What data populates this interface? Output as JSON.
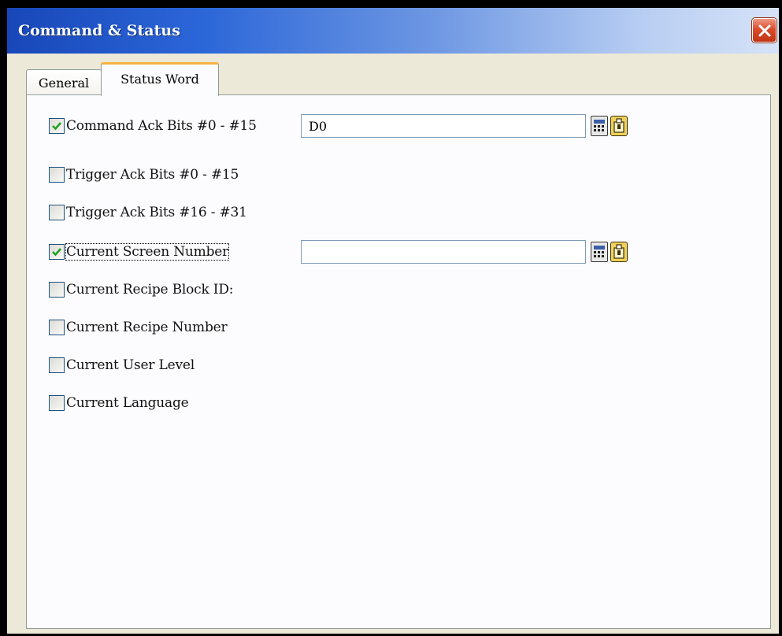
{
  "window": {
    "title": "Command & Status"
  },
  "tabs": [
    {
      "label": "General",
      "active": false
    },
    {
      "label": "Status Word",
      "active": true
    }
  ],
  "rows": [
    {
      "label": "Command Ack Bits #0 - #15",
      "checked": true,
      "address_value": "D0"
    },
    {
      "label": "Trigger Ack Bits #0 - #15",
      "checked": false
    },
    {
      "label": "Trigger Ack Bits #16 - #31",
      "checked": false
    },
    {
      "label": "Current Screen Number",
      "checked": true,
      "address_value": ""
    },
    {
      "label": "Current Recipe Block ID:",
      "checked": false
    },
    {
      "label": "Current Recipe Number",
      "checked": false
    },
    {
      "label": "Current User Level",
      "checked": false
    },
    {
      "label": "Current Language",
      "checked": false
    }
  ],
  "icons": {
    "close": "close-icon",
    "calculator": "calculator-icon",
    "address_tag": "address-tag-icon",
    "checkmark": "checkmark-icon"
  },
  "colors": {
    "titlebar_start": "#1847b8",
    "titlebar_end": "#d6e2f7",
    "active_tab_highlight": "#f7b03f",
    "checkmark": "#21a121",
    "close_button": "#db4c2b"
  }
}
